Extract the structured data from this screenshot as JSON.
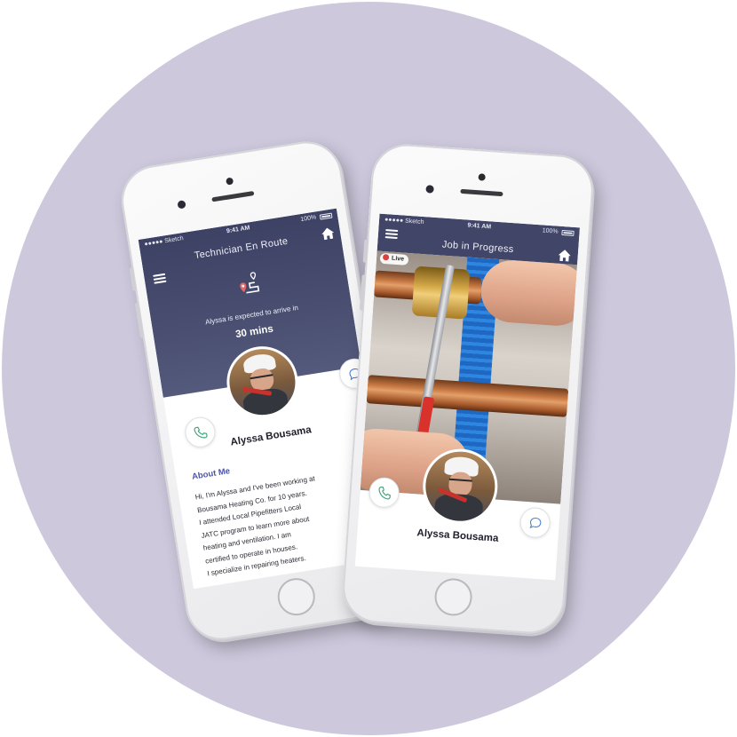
{
  "left_phone": {
    "status": {
      "carrier": "●●●●● Sketch",
      "time": "9:41 AM",
      "battery": "100%"
    },
    "header": {
      "title": "Technician En Route"
    },
    "eta": {
      "text": "Alyssa is expected to arrive in",
      "value": "30 mins"
    },
    "technician": {
      "name": "Alyssa Bousama"
    },
    "about": {
      "heading": "About Me",
      "lines": [
        "Hi, I'm Alyssa and I've been working at",
        "Bousama Heating Co. for 10 years.",
        "I attended Local Pipefitters Local",
        "JATC program to learn more about",
        "heating and ventilation. I am",
        "certified to operate in houses.",
        "I specialize in repairing heaters."
      ]
    },
    "icons": [
      "menu-icon",
      "home-icon",
      "route-pin-icon",
      "phone-icon",
      "chat-icon"
    ]
  },
  "right_phone": {
    "status": {
      "carrier": "●●●●● Sketch",
      "time": "9:41 AM",
      "battery": "100%"
    },
    "header": {
      "title": "Job in Progress"
    },
    "live_label": "Live",
    "technician": {
      "name": "Alyssa Bousama"
    },
    "icons": [
      "menu-icon",
      "home-icon",
      "live-dot-icon",
      "phone-icon",
      "chat-icon"
    ]
  },
  "colors": {
    "background_circle": "#cdc8dc",
    "header_navy": "#414668",
    "accent_green": "#3aa37a",
    "about_heading": "#4a55a8",
    "live_red": "#e0403a"
  }
}
